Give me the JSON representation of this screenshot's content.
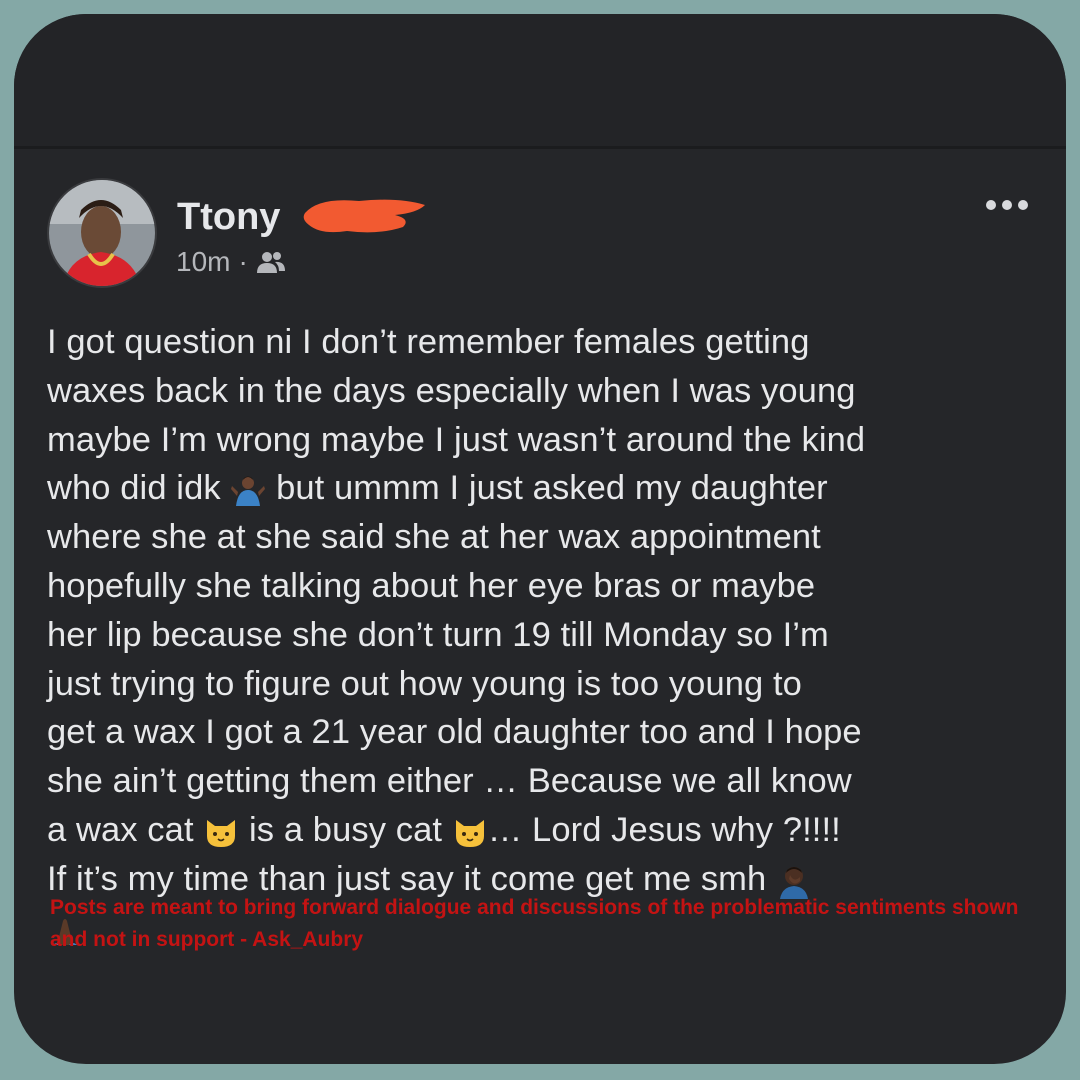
{
  "post": {
    "author_name": "Ttony",
    "time": "10m",
    "separator": "·",
    "audience_icon": "friends-icon",
    "more_icon": "more-options-icon",
    "body": {
      "segment1": "I got question ni I don’t remember females getting\nwaxes back in the days especially when I was young\nmaybe I’m wrong maybe I just wasn’t around the kind\nwho did idk ",
      "emoji1": "person-shrugging-emoji",
      "segment2": " but ummm I just asked my daughter\nwhere she at she said she at her wax appointment\nhopefully she talking about her eye bras or maybe\nher lip because she don’t turn 19 till Monday so I’m\njust trying to figure out how young is too young to\nget a wax I got a 21 year old daughter too and I hope\nshe ain’t getting them either … Because we all know\na wax cat ",
      "emoji2": "cat-face-emoji",
      "segment3": " is a busy cat ",
      "emoji3": "cat-face-emoji",
      "segment4": "… Lord Jesus why ?!!!!\nIf it’s my time than just say it come get me smh ",
      "emoji4": "person-facepalming-emoji",
      "emoji5": "folded-hands-emoji"
    }
  },
  "notice": {
    "text": "Posts are meant to bring forward dialogue and discussions of the problematic sentiments shown and not in support - Ask_Aubry"
  },
  "colors": {
    "background": "#84a8a6",
    "card": "#252629",
    "text": "#e7e8ea",
    "notice": "#c41313",
    "redaction": "#f25a31"
  }
}
